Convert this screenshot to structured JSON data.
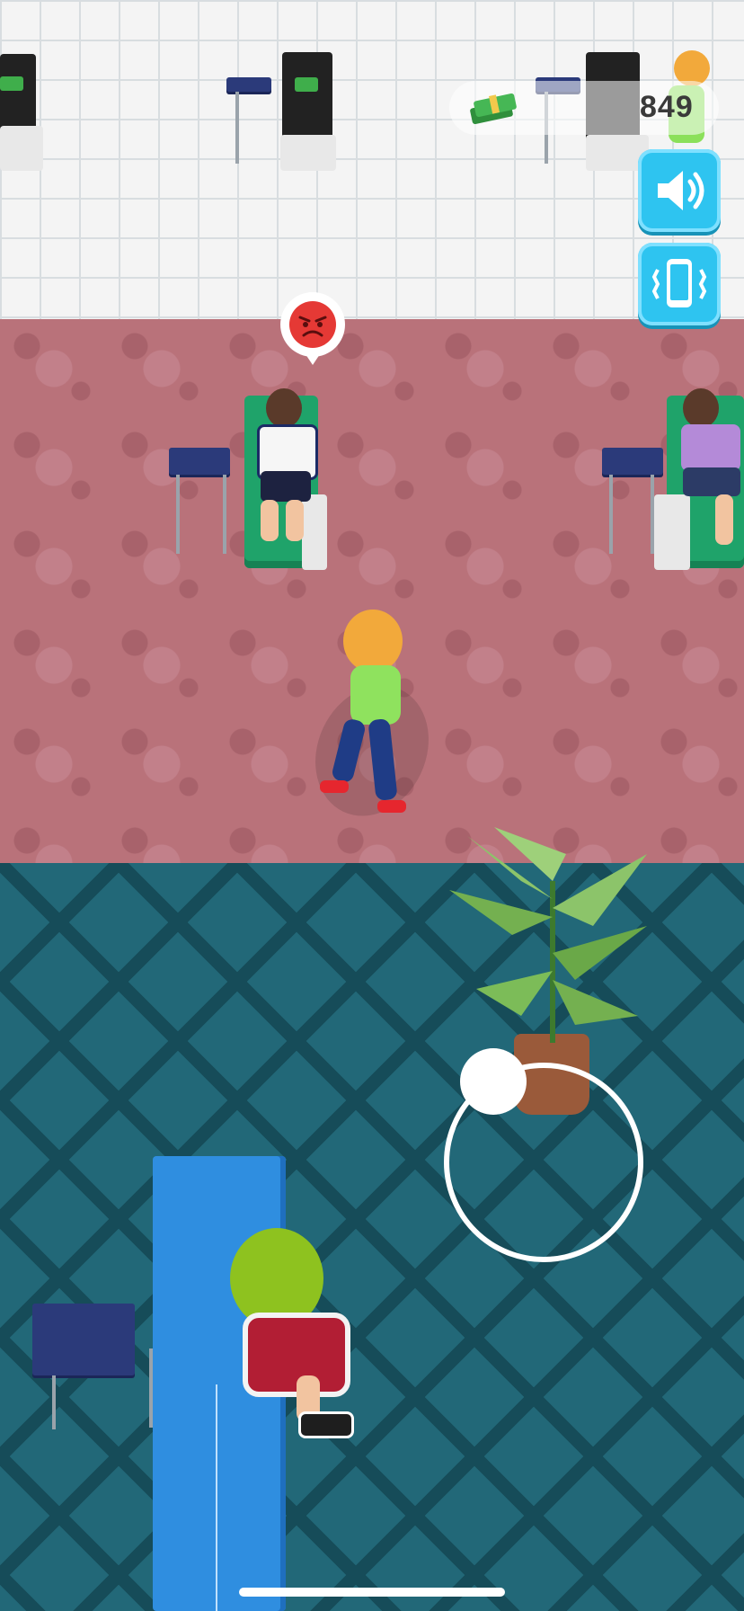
{
  "hud": {
    "money_value": "849",
    "money_icon": "cash-stack-icon",
    "sound_button_icon": "speaker-icon",
    "vibration_button_icon": "phone-vibrate-icon"
  },
  "scene": {
    "customer_mood_icon": "angry-face-icon",
    "joystick": "virtual-joystick"
  },
  "colors": {
    "accent_button": "#2ec4f0",
    "carpet": "#b9727a",
    "teal_floor": "#226878",
    "angry": "#e53935"
  }
}
